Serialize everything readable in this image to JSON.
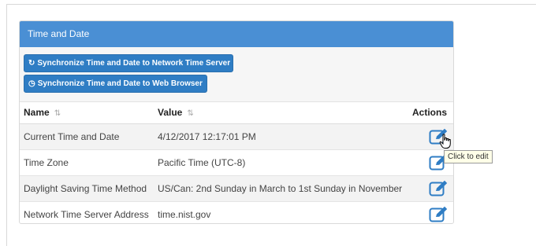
{
  "panel": {
    "title": "Time and Date"
  },
  "buttons": {
    "sync_network": {
      "icon": "sync-icon",
      "label": "Synchronize Time and Date to Network Time Server"
    },
    "sync_browser": {
      "icon": "clock-icon",
      "label": "Synchronize Time and Date to Web Browser"
    }
  },
  "table": {
    "columns": {
      "name": "Name",
      "value": "Value",
      "actions": "Actions"
    },
    "rows": [
      {
        "name": "Current Time and Date",
        "value": "4/12/2017 12:17:01 PM",
        "action_icon": "edit-icon"
      },
      {
        "name": "Time Zone",
        "value": "Pacific Time (UTC-8)",
        "action_icon": "edit-icon"
      },
      {
        "name": "Daylight Saving Time Method",
        "value": "US/Can: 2nd Sunday in March to 1st Sunday in November",
        "action_icon": "edit-icon"
      },
      {
        "name": "Network Time Server Address",
        "value": "time.nist.gov",
        "action_icon": "edit-icon"
      }
    ]
  },
  "tooltip": {
    "text": "Click to edit"
  },
  "colors": {
    "header": "#4a8fd4",
    "button": "#2f7dc4",
    "edit_icon": "#2f7dc4"
  }
}
